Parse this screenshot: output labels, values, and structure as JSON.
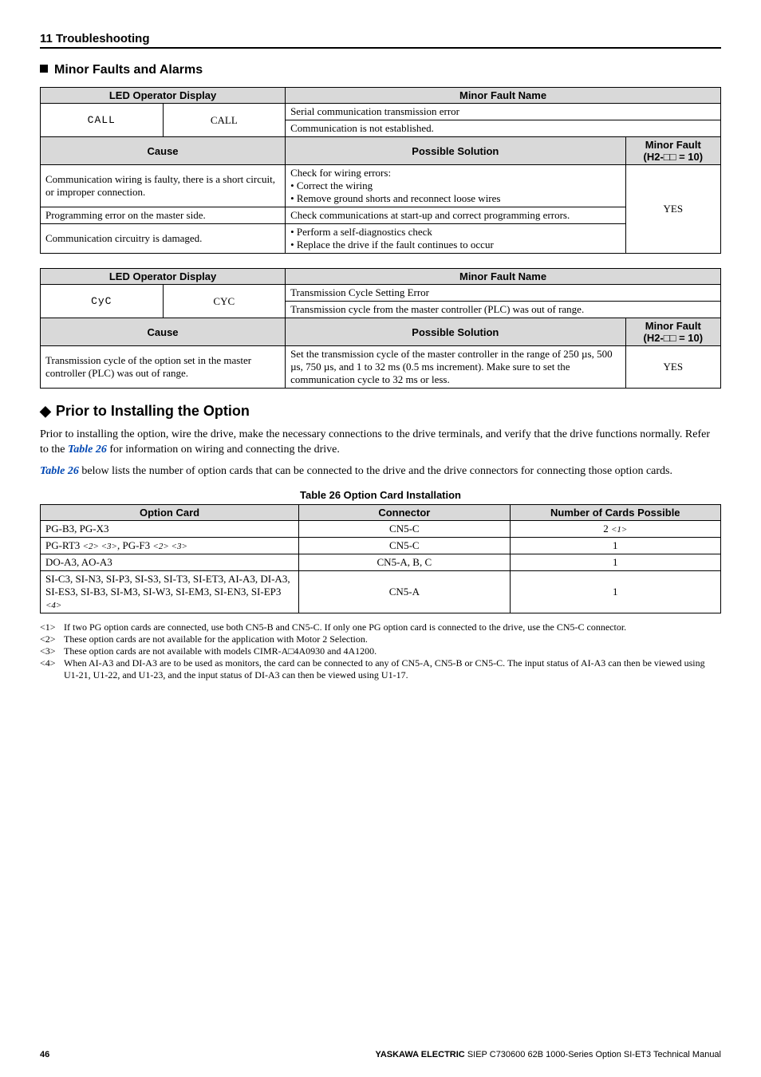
{
  "header": {
    "section": "11  Troubleshooting"
  },
  "subheading": "Minor Faults and Alarms",
  "fault1": {
    "col_display": "LED Operator Display",
    "col_name": "Minor Fault Name",
    "seg": "CALL",
    "code": "CALL",
    "name1": "Serial communication transmission error",
    "name2": "Communication is not established.",
    "col_cause": "Cause",
    "col_solution": "Possible Solution",
    "col_minor": "Minor Fault\n(H2-□□ = 10)",
    "cause1": "Communication wiring is faulty, there is a short circuit, or improper connection.",
    "sol1": "Check for wiring errors:\n• Correct the wiring\n• Remove ground shorts and reconnect loose wires",
    "cause2": "Programming error on the master side.",
    "sol2": "Check communications at start-up and correct programming errors.",
    "cause3": "Communication circuitry is damaged.",
    "sol3": "• Perform a self-diagnostics check\n• Replace the drive if the fault continues to occur",
    "yes": "YES"
  },
  "fault2": {
    "col_display": "LED Operator Display",
    "col_name": "Minor Fault Name",
    "seg": "CyC",
    "code": "CYC",
    "name1": "Transmission Cycle Setting Error",
    "name2": "Transmission cycle from the master controller (PLC) was out of range.",
    "col_cause": "Cause",
    "col_solution": "Possible Solution",
    "col_minor": "Minor Fault\n(H2-□□ = 10)",
    "cause1": "Transmission cycle of the option set in the master controller (PLC) was out of range.",
    "sol1": "Set the transmission cycle of the master controller in the range of 250 µs, 500 µs, 750 µs, and 1 to 32 ms (0.5 ms increment). Make sure to set the communication cycle to 32 ms or less.",
    "yes": "YES"
  },
  "prior_heading": "Prior to Installing the Option",
  "para1_a": "Prior to installing the option, wire the drive, make the necessary connections to the drive terminals, and verify that the drive functions normally. Refer to the ",
  "para1_link": "Table 26",
  "para1_b": " for information on wiring and connecting the drive.",
  "para2_link": "Table 26",
  "para2_b": " below lists the number of option cards that can be connected to the drive and the drive connectors for connecting those option cards.",
  "table26": {
    "caption": "Table 26  Option Card Installation",
    "h1": "Option Card",
    "h2": "Connector",
    "h3": "Number of Cards Possible",
    "rows": [
      {
        "c1": "PG-B3, PG-X3",
        "c2": "CN5-C",
        "c3": "2 ",
        "c3_sup": "<1>"
      },
      {
        "c1_a": "PG-RT3 ",
        "c1_sup1": "<2> <3>",
        "c1_b": ", PG-F3 ",
        "c1_sup2": "<2> <3>",
        "c2": "CN5-C",
        "c3": "1"
      },
      {
        "c1": "DO-A3, AO-A3",
        "c2": "CN5-A, B, C",
        "c3": "1"
      },
      {
        "c1_a": "SI-C3, SI-N3, SI-P3, SI-S3, SI-T3, SI-ET3, AI-A3, DI-A3, SI-ES3, SI-B3, SI-M3, SI-W3, SI-EM3, SI-EN3, SI-EP3 ",
        "c1_sup1": "<4>",
        "c2": "CN5-A",
        "c3": "1"
      }
    ]
  },
  "notes": [
    {
      "tag": "<1>",
      "text": "If two PG option cards are connected, use both CN5-B and CN5-C. If only one PG option card is connected to the drive, use the CN5-C connector."
    },
    {
      "tag": "<2>",
      "text": "These option cards are not available for the application with Motor 2 Selection."
    },
    {
      "tag": "<3>",
      "text": "These option cards are not available with models CIMR-A□4A0930 and 4A1200."
    },
    {
      "tag": "<4>",
      "text": "When AI-A3 and DI-A3 are to be used as monitors, the card can be connected to any of CN5-A, CN5-B or CN5-C. The input status of AI-A3 can then be viewed using U1-21, U1-22, and U1-23, and the input status of DI-A3 can then be viewed using U1-17."
    }
  ],
  "footer": {
    "page": "46",
    "brand": "YASKAWA ELECTRIC",
    "doc": " SIEP C730600 62B 1000-Series Option SI-ET3 Technical Manual"
  }
}
